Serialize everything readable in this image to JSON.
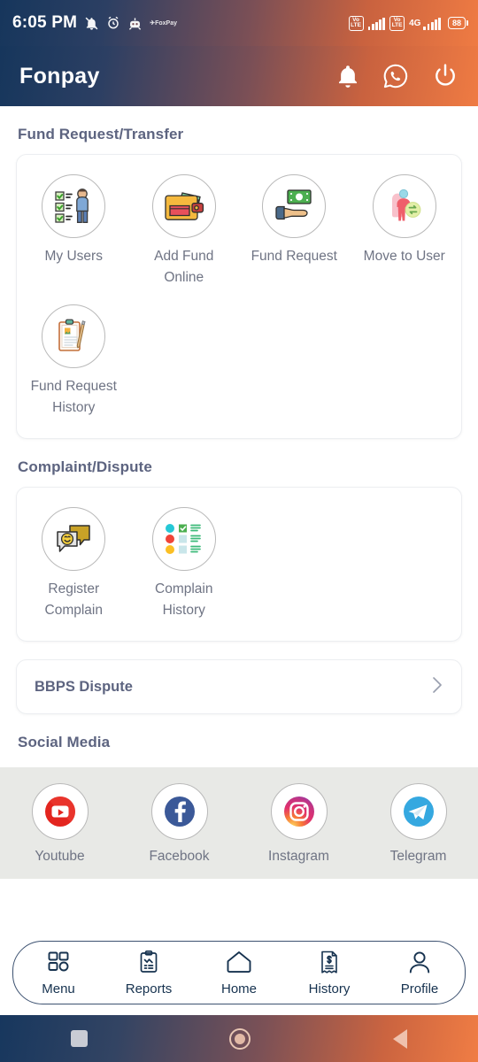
{
  "status_bar": {
    "time": "6:05 PM",
    "icons": [
      "mute-icon",
      "alarm-icon",
      "robot-icon",
      "foxpay-icon"
    ],
    "network": {
      "volte_1": "VoLTE",
      "volte_2": "VoLTE",
      "data_type": "4G"
    },
    "battery": "88"
  },
  "header": {
    "brand": "Fonpay",
    "actions": [
      {
        "name": "notification-bell-icon",
        "label": "Notifications"
      },
      {
        "name": "whatsapp-icon",
        "label": "WhatsApp"
      },
      {
        "name": "power-icon",
        "label": "Logout"
      }
    ]
  },
  "sections": {
    "fund": {
      "title": "Fund Request/Transfer",
      "tiles": [
        {
          "label": "My Users",
          "icon": "checklist-user-icon"
        },
        {
          "label": "Add Fund Online",
          "icon": "wallet-icon"
        },
        {
          "label": "Fund Request",
          "icon": "hand-money-icon"
        },
        {
          "label": "Move to User",
          "icon": "user-transfer-icon"
        },
        {
          "label": "Fund Request History",
          "icon": "clipboard-pen-icon"
        }
      ]
    },
    "complaint": {
      "title": "Complaint/Dispute",
      "tiles": [
        {
          "label": "Register Complain",
          "icon": "chat-bubbles-icon"
        },
        {
          "label": "Complain History",
          "icon": "list-dots-icon"
        }
      ]
    },
    "bbps": {
      "label": "BBPS Dispute",
      "chevron": "chevron-right-icon"
    },
    "social": {
      "title": "Social Media",
      "tiles": [
        {
          "label": "Youtube",
          "icon": "youtube-icon",
          "color": "#e3251f"
        },
        {
          "label": "Facebook",
          "icon": "facebook-icon",
          "color": "#3b5998"
        },
        {
          "label": "Instagram",
          "icon": "instagram-icon",
          "color": "#d6249f"
        },
        {
          "label": "Telegram",
          "icon": "telegram-icon",
          "color": "#35a8e0"
        }
      ]
    }
  },
  "bottom_nav": {
    "items": [
      {
        "label": "Menu",
        "icon": "grid-icon"
      },
      {
        "label": "Reports",
        "icon": "clipboard-chart-icon"
      },
      {
        "label": "Home",
        "icon": "home-icon"
      },
      {
        "label": "History",
        "icon": "receipt-icon"
      },
      {
        "label": "Profile",
        "icon": "person-icon"
      }
    ]
  },
  "system_nav": {
    "items": [
      {
        "name": "recents-button",
        "icon": "square-icon"
      },
      {
        "name": "home-button",
        "icon": "circle-icon"
      },
      {
        "name": "back-button",
        "icon": "triangle-icon"
      }
    ]
  },
  "theme": {
    "gradient_start": "#16365c",
    "gradient_end": "#ef7b43",
    "heading_color": "#5d6480",
    "label_color": "#6f7484",
    "nav_color": "#16324f",
    "social_panel_bg": "#e8e9e6"
  }
}
